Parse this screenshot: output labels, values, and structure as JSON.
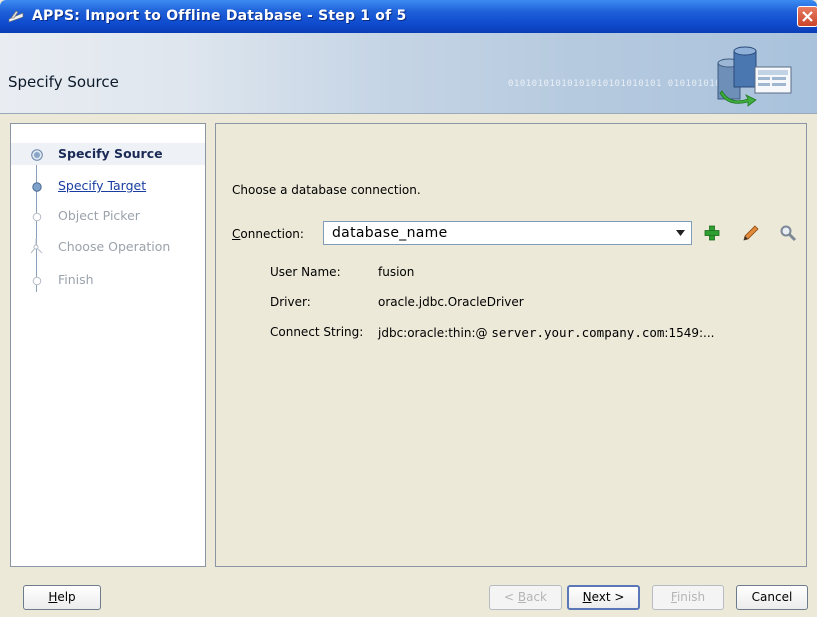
{
  "window": {
    "title": "APPS: Import to Offline Database - Step 1 of 5"
  },
  "header": {
    "step_title": "Specify Source",
    "binary_text": "01010101010101010101010101 0101010101"
  },
  "train": {
    "items": [
      {
        "label": "Specify Source",
        "state": "active"
      },
      {
        "label": "Specify Target",
        "state": "link"
      },
      {
        "label": "Object Picker",
        "state": "disabled"
      },
      {
        "label": "Choose Operation",
        "state": "disabled"
      },
      {
        "label": "Finish",
        "state": "disabled"
      }
    ]
  },
  "main": {
    "prompt": "Choose a database connection.",
    "connection_label_mnemonic": "C",
    "connection_label_rest": "onnection:",
    "connection_value": "database_name",
    "details": [
      {
        "label": "User Name:",
        "value": "fusion"
      },
      {
        "label": "Driver:",
        "value": "oracle.jdbc.OracleDriver"
      },
      {
        "label": "Connect String:",
        "value_prefix": "jdbc:oracle:thin:@",
        "value_host": "server.your.company.com",
        "value_suffix": ":1549:..."
      }
    ],
    "tools": [
      "add-icon",
      "edit-pencil-icon",
      "search-magnifier-icon"
    ]
  },
  "buttons": {
    "help": {
      "mnemonic": "H",
      "rest": "elp"
    },
    "back": {
      "prefix": "< ",
      "mnemonic": "B",
      "rest": "ack"
    },
    "next": {
      "mnemonic": "N",
      "rest": "ext >"
    },
    "finish": {
      "mnemonic": "F",
      "rest": "inish"
    },
    "cancel": {
      "label": "Cancel"
    }
  },
  "colors": {
    "titlebar": "#1f60d8",
    "link": "#1a3ea0",
    "disabled_text": "#9aa2ab",
    "add_icon": "#2e9e2e",
    "pencil_icon": "#c8641c"
  }
}
